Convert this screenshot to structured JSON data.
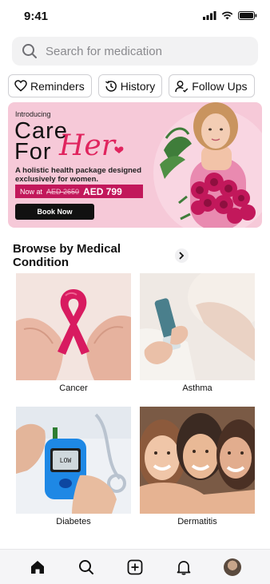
{
  "status_bar": {
    "time": "9:41"
  },
  "search": {
    "placeholder": "Search for medication"
  },
  "quick_actions": [
    {
      "label": "Reminders",
      "icon": "heart-icon"
    },
    {
      "label": "History",
      "icon": "history-icon"
    },
    {
      "label": "Follow Ups",
      "icon": "user-check-icon"
    }
  ],
  "banner": {
    "intro": "Introducing",
    "title_line1": "Care",
    "title_line2": "For",
    "title_script": "Her",
    "description": "A holistic health package designed exclusively for women.",
    "price_prefix": "Now at",
    "old_price": "AED 2650",
    "new_price": "AED 799",
    "button_label": "Book Now",
    "colors": {
      "background": "#f6c9d8",
      "accent": "#e0245e",
      "price_band": "#c2185b"
    }
  },
  "conditions_section": {
    "title": "Browse by Medical Condition",
    "items": [
      {
        "label": "Cancer"
      },
      {
        "label": "Asthma"
      },
      {
        "label": "Diabetes"
      },
      {
        "label": "Dermatitis"
      }
    ]
  },
  "tab_bar": {
    "items": [
      {
        "icon": "home-icon",
        "active": true
      },
      {
        "icon": "search-icon",
        "active": false
      },
      {
        "icon": "add-icon",
        "active": false
      },
      {
        "icon": "bell-icon",
        "active": false
      },
      {
        "icon": "profile-avatar",
        "active": false
      }
    ]
  }
}
